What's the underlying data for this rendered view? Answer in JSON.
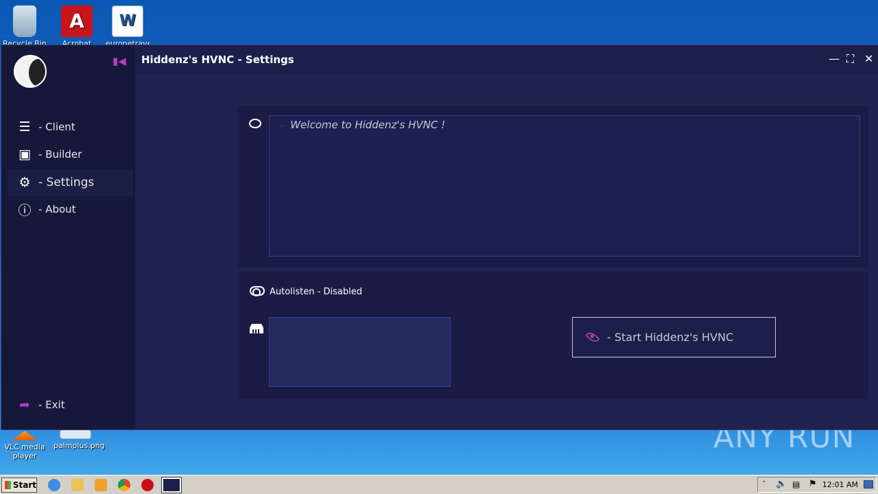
{
  "desktop": {
    "icons": [
      {
        "label": "Recycle Bin"
      },
      {
        "label": "Acrobat Reader DC"
      },
      {
        "label": "europetrave"
      },
      {
        "label": "VLC media player"
      },
      {
        "label": "palmplus.png"
      }
    ],
    "watermark": "ANY RUN"
  },
  "app": {
    "title": "Hiddenz's HVNC - Settings",
    "nav": [
      {
        "label": "- Client",
        "icon": "list-icon"
      },
      {
        "label": "- Builder",
        "icon": "floppy-icon"
      },
      {
        "label": "- Settings",
        "icon": "gears-icon"
      },
      {
        "label": "- About",
        "icon": "info-icon"
      }
    ],
    "exit_label": "- Exit",
    "welcome_text": "Welcome to Hiddenz's HVNC !",
    "autolisten_label": "Autolisten - Disabled",
    "start_label": "- Start Hiddenz's HVNC",
    "port_value": ""
  },
  "taskbar": {
    "start_label": "Start",
    "clock": "12:01 AM"
  },
  "colors": {
    "accent": "#b23dbd",
    "sidebar": "#16183a",
    "panel": "#20234f"
  }
}
